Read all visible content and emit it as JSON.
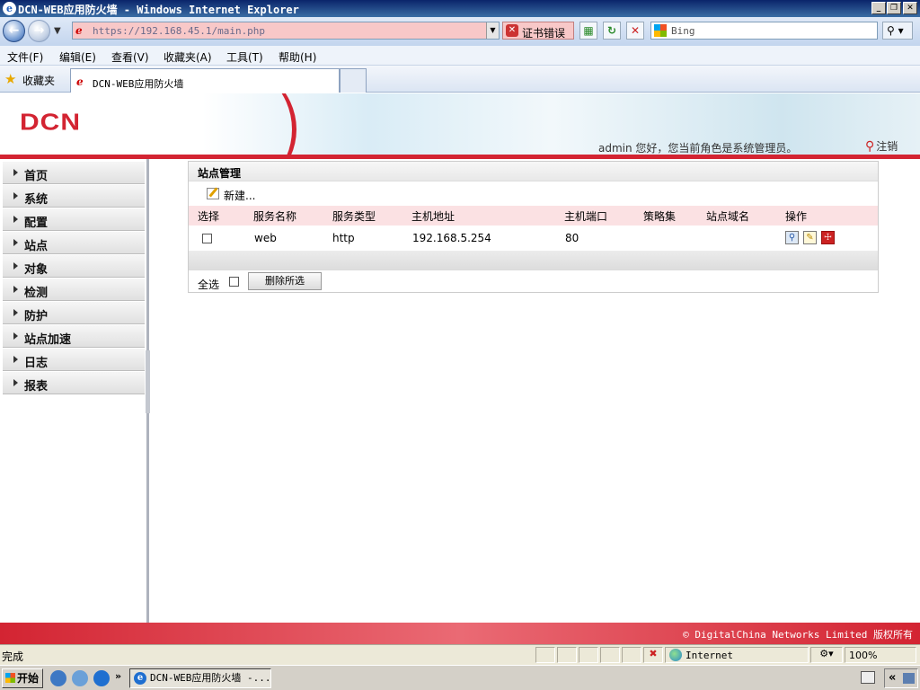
{
  "window": {
    "title": "DCN-WEB应用防火墙 - Windows Internet Explorer",
    "controls": [
      "_",
      "❐",
      "✕"
    ]
  },
  "browser": {
    "url": "https://192.168.45.1/main.php",
    "cert_error": "证书错误",
    "search_placeholder": "Bing",
    "menu": [
      "文件(F)",
      "编辑(E)",
      "查看(V)",
      "收藏夹(A)",
      "工具(T)",
      "帮助(H)"
    ],
    "favorites_label": "收藏夹",
    "tab_title": "DCN-WEB应用防火墙",
    "status_text": "完成",
    "zone": "Internet",
    "zoom": "100%"
  },
  "app": {
    "logo": "DCN",
    "welcome": "admin 您好，您当前角色是系统管理员。",
    "logout": "注销",
    "nav": [
      "首页",
      "系统",
      "配置",
      "站点",
      "对象",
      "检测",
      "防护",
      "站点加速",
      "日志",
      "报表"
    ],
    "footer": "© DigitalChina Networks Limited 版权所有"
  },
  "panel": {
    "title": "站点管理",
    "new_label": "新建...",
    "columns": [
      "选择",
      "服务名称",
      "服务类型",
      "主机地址",
      "主机端口",
      "策略集",
      "站点域名",
      "操作"
    ],
    "rows": [
      {
        "service_name": "web",
        "service_type": "http",
        "host": "192.168.5.254",
        "port": "80",
        "policy": "",
        "domain": ""
      }
    ],
    "select_all_label": "全选",
    "delete_selected": "删除所选"
  },
  "taskbar": {
    "start": "开始",
    "task_title": "DCN-WEB应用防火墙 -..."
  }
}
